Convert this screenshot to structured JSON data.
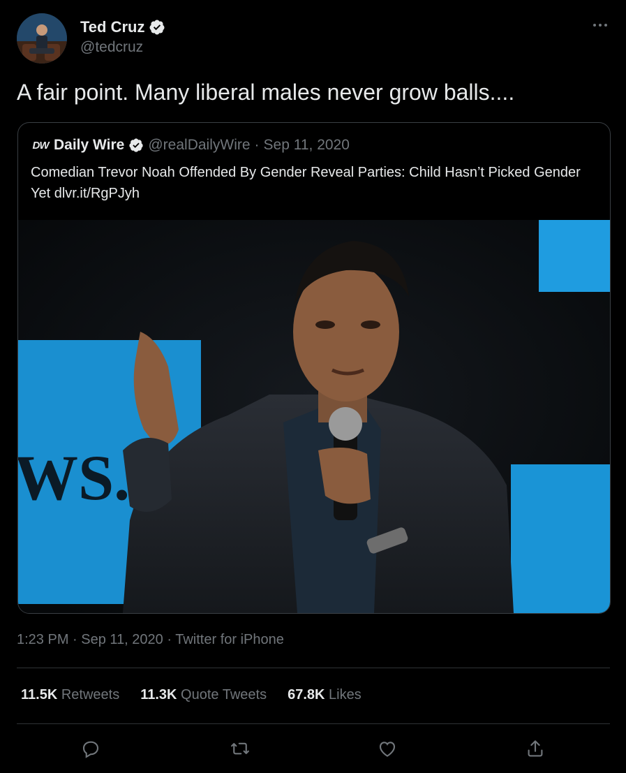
{
  "author": {
    "display_name": "Ted Cruz",
    "handle": "@tedcruz",
    "verified": true
  },
  "tweet": {
    "text": "A fair point. Many liberal males never grow balls....",
    "time": "1:23 PM",
    "date": "Sep 11, 2020",
    "source": "Twitter for iPhone",
    "separator": "·"
  },
  "quoted_tweet": {
    "logo_text": "DW",
    "display_name": "Daily Wire",
    "handle": "@realDailyWire",
    "date": "Sep 11, 2020",
    "separator": "·",
    "text": "Comedian Trevor Noah Offended By Gender Reveal Parties: Child Hasn’t Picked Gender Yet dlvr.it/RgPJyh",
    "image_backdrop_text": "WS.J"
  },
  "stats": [
    {
      "count": "11.5K",
      "label": "Retweets"
    },
    {
      "count": "11.3K",
      "label": "Quote Tweets"
    },
    {
      "count": "67.8K",
      "label": "Likes"
    }
  ],
  "actions": [
    "reply-icon",
    "retweet-icon",
    "like-icon",
    "share-icon"
  ],
  "colors": {
    "background": "#000000",
    "primary_text": "#e7e9ea",
    "secondary_text": "#71767b",
    "verified_badge": "#e7e9ea",
    "border": "#2f3336"
  }
}
